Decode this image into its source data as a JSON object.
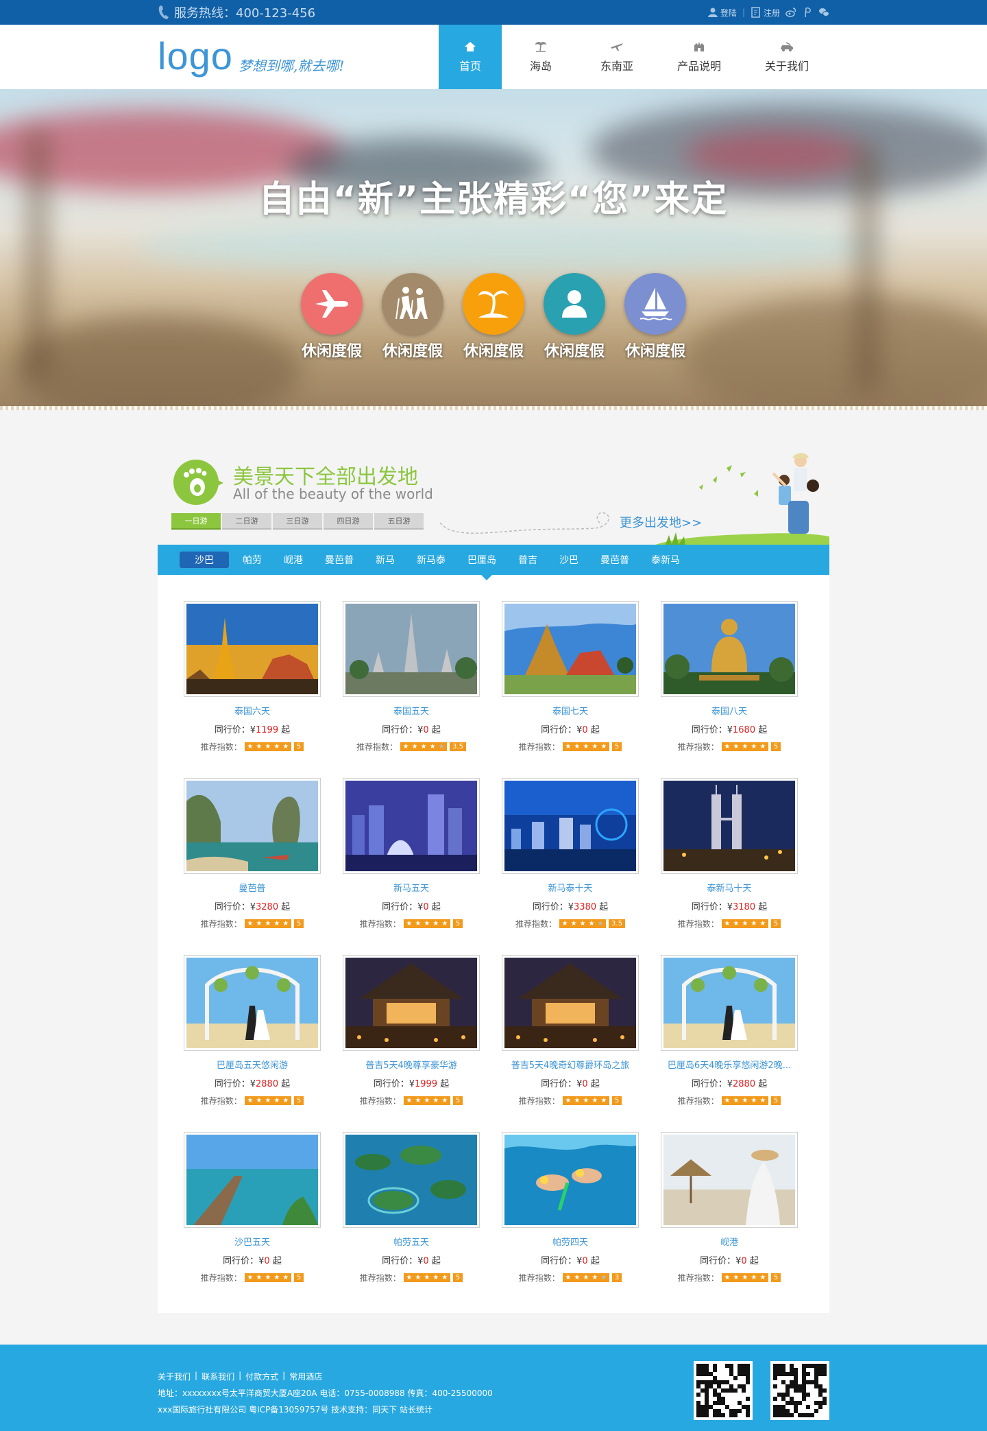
{
  "topbar": {
    "hotline": "服务热线：400-123-456",
    "login": "登陆",
    "register": "注册",
    "icons": [
      "user-icon",
      "register-icon",
      "weibo-icon",
      "weixin-icon",
      "wechat-icon"
    ]
  },
  "header": {
    "logo": "logo",
    "slogan": "梦想到哪,就去哪!",
    "nav": [
      {
        "label": "首页",
        "icon": "home-icon",
        "active": true
      },
      {
        "label": "海岛",
        "icon": "island-icon"
      },
      {
        "label": "东南亚",
        "icon": "plane-icon"
      },
      {
        "label": "产品说明",
        "icon": "castle-icon"
      },
      {
        "label": "关于我们",
        "icon": "car-icon"
      }
    ]
  },
  "banner": {
    "title": "自由“新”主张精彩“您”来定",
    "features": [
      {
        "label": "休闲度假",
        "icon": "airplane-icon",
        "color": "#ef6f6f"
      },
      {
        "label": "休闲度假",
        "icon": "hikers-icon",
        "color": "#a28a6a"
      },
      {
        "label": "休闲度假",
        "icon": "palm-tree-icon",
        "color": "#f7a00c"
      },
      {
        "label": "休闲度假",
        "icon": "person-icon",
        "color": "#2aa1b1"
      },
      {
        "label": "休闲度假",
        "icon": "sailboat-icon",
        "color": "#7b8fd1"
      }
    ]
  },
  "section": {
    "title": "美景天下全部出发地",
    "subtitle": "All of the beauty of the world",
    "day_tabs": [
      "一日游",
      "二日游",
      "三日游",
      "四日游",
      "五日游"
    ],
    "more": "更多出发地>>"
  },
  "cities": [
    "沙巴",
    "帕劳",
    "岘港",
    "曼芭普",
    "新马",
    "新马泰",
    "巴厘岛",
    "普吉",
    "沙巴",
    "曼芭普",
    "泰新马"
  ],
  "products": [
    {
      "name": "泰国六天",
      "price_label": "同行价：",
      "currency": "¥",
      "price": "1199",
      "suffix": "起",
      "rate_label": "推荐指数：",
      "stars": 5,
      "score": "5",
      "scene": "pagoda"
    },
    {
      "name": "泰国五天",
      "price_label": "同行价：",
      "currency": "¥",
      "price": "0",
      "suffix": "起",
      "rate_label": "推荐指数：",
      "stars": 4,
      "score": "3.5",
      "scene": "temple"
    },
    {
      "name": "泰国七天",
      "price_label": "同行价：",
      "currency": "¥",
      "price": "0",
      "suffix": "起",
      "rate_label": "推荐指数：",
      "stars": 5,
      "score": "5",
      "scene": "palace"
    },
    {
      "name": "泰国八天",
      "price_label": "同行价：",
      "currency": "¥",
      "price": "1680",
      "suffix": "起",
      "rate_label": "推荐指数：",
      "stars": 5,
      "score": "5",
      "scene": "buddha"
    },
    {
      "name": "曼芭普",
      "price_label": "同行价：",
      "currency": "¥",
      "price": "3280",
      "suffix": "起",
      "rate_label": "推荐指数：",
      "stars": 5,
      "score": "5",
      "scene": "rock"
    },
    {
      "name": "新马五天",
      "price_label": "同行价：",
      "currency": "¥",
      "price": "0",
      "suffix": "起",
      "rate_label": "推荐指数：",
      "stars": 5,
      "score": "5",
      "scene": "citynight"
    },
    {
      "name": "新马泰十天",
      "price_label": "同行价：",
      "currency": "¥",
      "price": "3380",
      "suffix": "起",
      "rate_label": "推荐指数：",
      "stars": 4,
      "score": "3.5",
      "scene": "skyline"
    },
    {
      "name": "泰新马十天",
      "price_label": "同行价：",
      "currency": "¥",
      "price": "3180",
      "suffix": "起",
      "rate_label": "推荐指数：",
      "stars": 5,
      "score": "5",
      "scene": "towers"
    },
    {
      "name": "巴厘岛五天悠闲游",
      "price_label": "同行价：",
      "currency": "¥",
      "price": "2880",
      "suffix": "起",
      "rate_label": "推荐指数：",
      "stars": 5,
      "score": "5",
      "scene": "wedding"
    },
    {
      "name": "普吉5天4晚尊享豪华游",
      "price_label": "同行价：",
      "currency": "¥",
      "price": "1999",
      "suffix": "起",
      "rate_label": "推荐指数：",
      "stars": 5,
      "score": "5",
      "scene": "resort"
    },
    {
      "name": "普吉5天4晚奇幻尊爵环岛之旅",
      "price_label": "同行价：",
      "currency": "¥",
      "price": "0",
      "suffix": "起",
      "rate_label": "推荐指数：",
      "stars": 5,
      "score": "5",
      "scene": "resort"
    },
    {
      "name": "巴厘岛6天4晚乐享悠闲游2晚...",
      "price_label": "同行价：",
      "currency": "¥",
      "price": "2880",
      "suffix": "起",
      "rate_label": "推荐指数：",
      "stars": 5,
      "score": "5",
      "scene": "wedding"
    },
    {
      "name": "沙巴五天",
      "price_label": "同行价：",
      "currency": "¥",
      "price": "0",
      "suffix": "起",
      "rate_label": "推荐指数：",
      "stars": 5,
      "score": "5",
      "scene": "pier"
    },
    {
      "name": "帕劳五天",
      "price_label": "同行价：",
      "currency": "¥",
      "price": "0",
      "suffix": "起",
      "rate_label": "推荐指数：",
      "stars": 5,
      "score": "5",
      "scene": "islands"
    },
    {
      "name": "帕劳四天",
      "price_label": "同行价：",
      "currency": "¥",
      "price": "0",
      "suffix": "起",
      "rate_label": "推荐指数：",
      "stars": 4,
      "score": "3",
      "scene": "snorkel"
    },
    {
      "name": "岘港",
      "price_label": "同行价：",
      "currency": "¥",
      "price": "0",
      "suffix": "起",
      "rate_label": "推荐指数：",
      "stars": 5,
      "score": "5",
      "scene": "beach"
    }
  ],
  "footer": {
    "links": [
      "关于我们",
      "联系我们",
      "付款方式",
      "常用酒店"
    ],
    "address": "地址：xxxxxxxx号太平洋商贸大厦A座20A  电话：0755-0008988  传真：400-25500000",
    "copyright": "xxx国际旅行社有限公司  粤ICP备13059757号  技术支持：同天下  站长统计"
  },
  "colors": {
    "topbar": "#1060a8",
    "accent": "#28a8e0",
    "green": "#8cc63f",
    "price": "#e02020",
    "star": "#f29a1b"
  }
}
